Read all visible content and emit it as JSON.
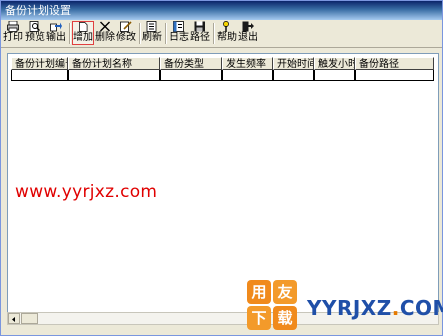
{
  "window": {
    "title": "备份计划设置"
  },
  "toolbar": {
    "print": "打印",
    "preview": "预览",
    "export": "输出",
    "add": "增加",
    "delete": "删除",
    "modify": "修改",
    "refresh": "刷新",
    "log": "日志",
    "path": "路径",
    "help": "帮助",
    "exit": "退出"
  },
  "grid": {
    "columns": [
      "备份计划编号",
      "备份计划名称",
      "备份类型",
      "发生频率",
      "开始时间",
      "触发小时",
      "备份路径"
    ]
  },
  "watermark": {
    "url": "www.yyrjxz.com",
    "badge": [
      "用",
      "友",
      "下",
      "载"
    ],
    "site_main": "YYRJXZ",
    "site_dot": ".",
    "site_tail": "COM"
  }
}
